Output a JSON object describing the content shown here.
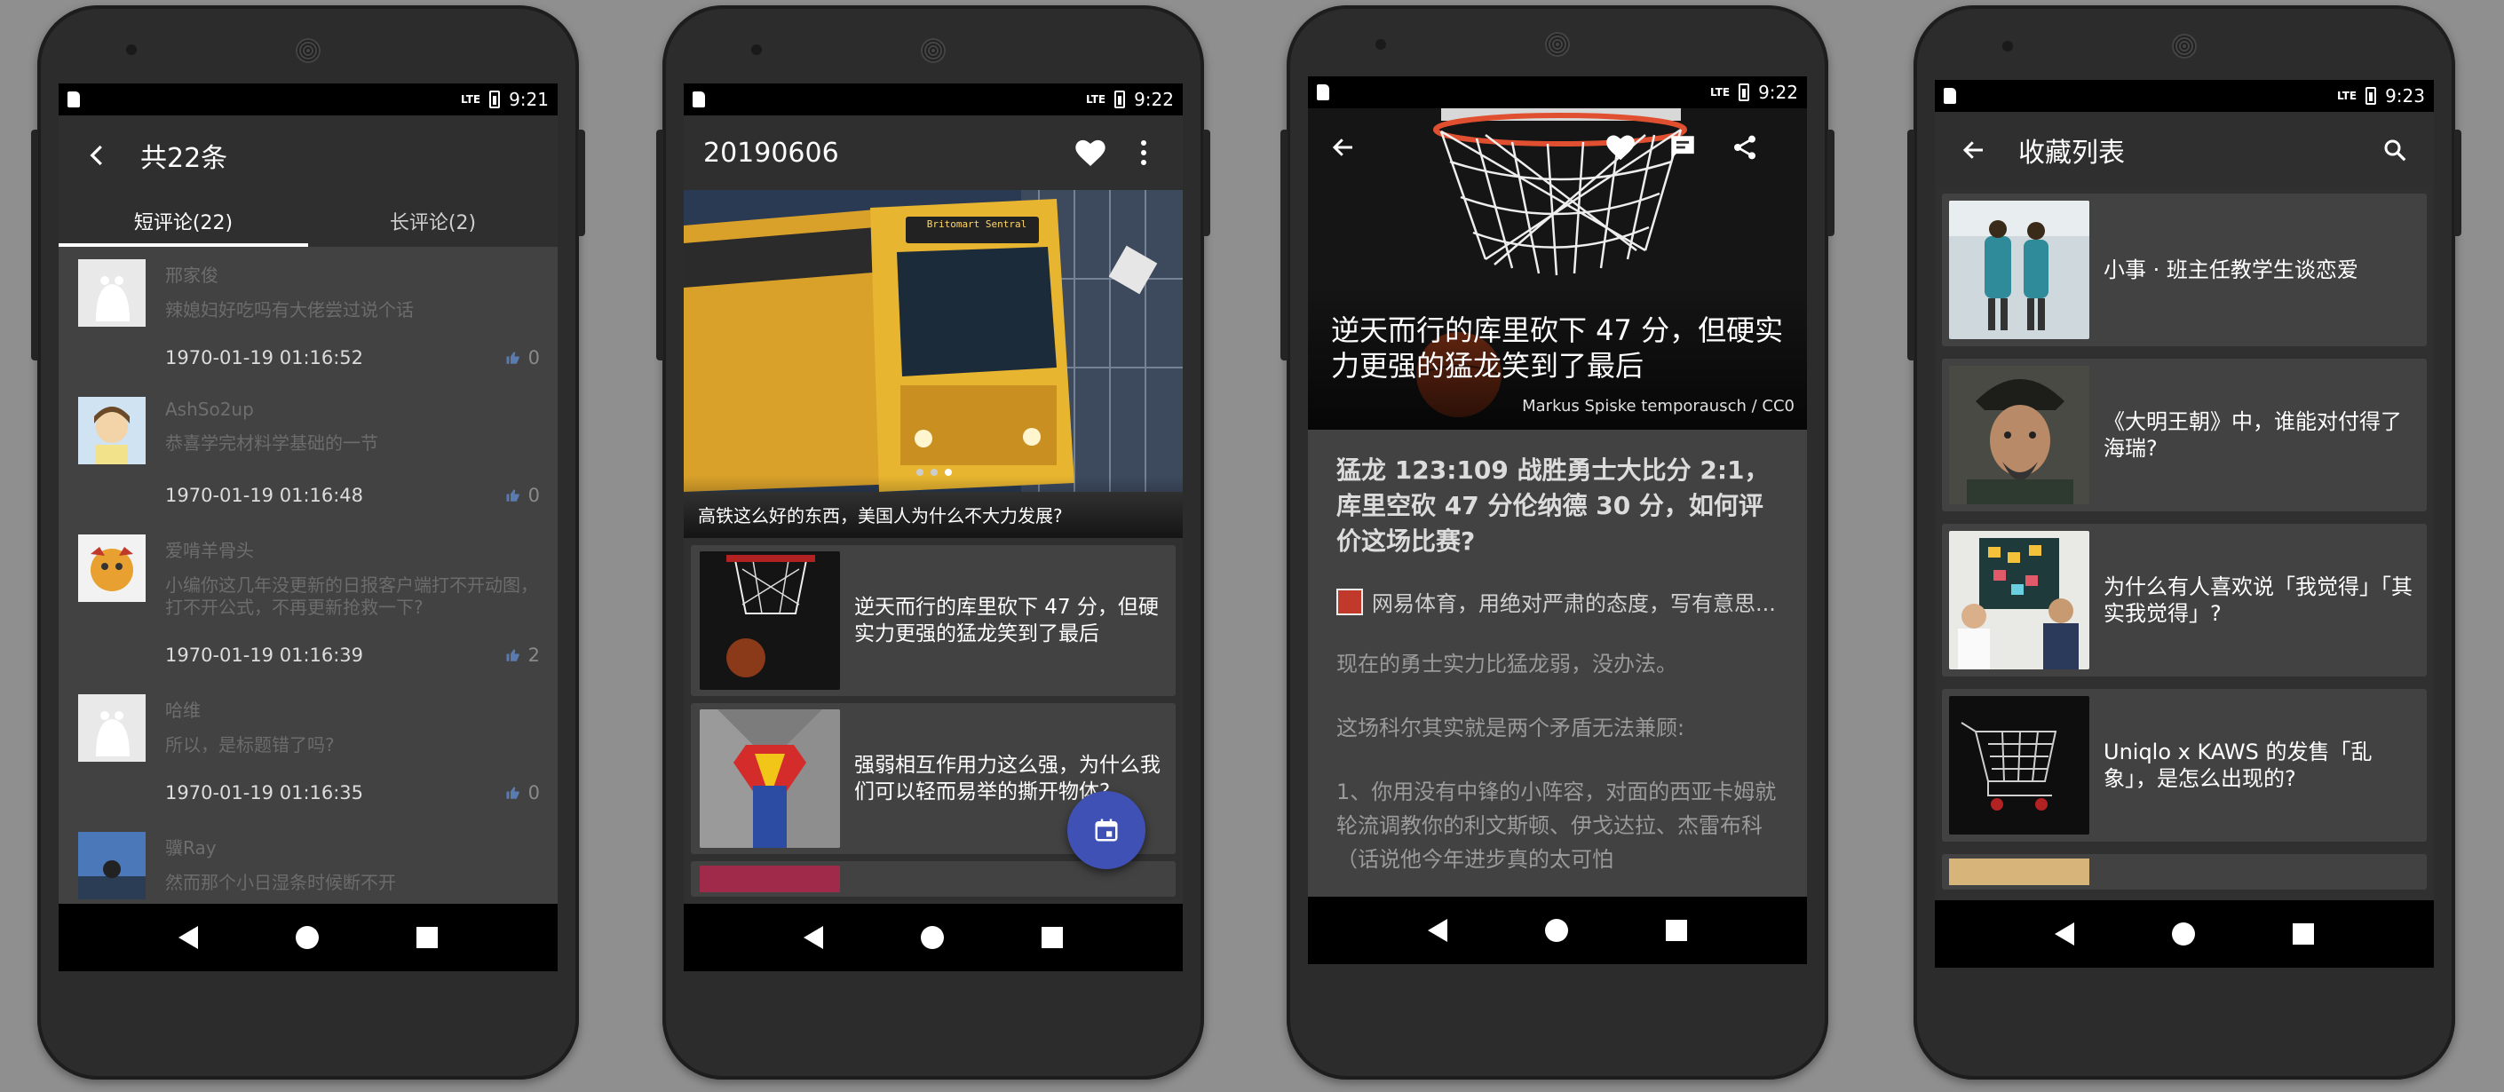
{
  "status": {
    "p1_time": "9:21",
    "p2_time": "9:22",
    "p3_time": "9:22",
    "p4_time": "9:23",
    "network": "LTE"
  },
  "comments_screen": {
    "title": "共22条",
    "tabs": [
      {
        "label": "短评论(22)"
      },
      {
        "label": "长评论(2)"
      }
    ],
    "comments": [
      {
        "name": "邢家俊",
        "text": "辣媳妇好吃吗有大佬尝过说个话",
        "time": "1970-01-19 01:16:52",
        "likes": "0"
      },
      {
        "name": "AshSo2up",
        "text": "恭喜学完材料学基础的一节",
        "time": "1970-01-19 01:16:48",
        "likes": "0"
      },
      {
        "name": "爱啃羊骨头",
        "text": "小编你这几年没更新的日报客户端打不开动图，打不开公式，不再更新抢救一下?",
        "time": "1970-01-19 01:16:39",
        "likes": "2"
      },
      {
        "name": "哈维",
        "text": "所以，是标题错了吗?",
        "time": "1970-01-19 01:16:35",
        "likes": "0"
      },
      {
        "name": "骥Ray",
        "text": "然而那个小日湿条时候断不开",
        "time": "",
        "likes": ""
      }
    ]
  },
  "daily_screen": {
    "title": "20190606",
    "hero_caption": "高铁这么好的东西，美国人为什么不大力发展?",
    "train_sign": "Britomart Sentral",
    "stories": [
      {
        "title": "逆天而行的库里砍下 47 分，但硬实力更强的猛龙笑到了最后"
      },
      {
        "title": "强弱相互作用力这么强，为什么我们可以轻而易举的撕开物体?"
      }
    ]
  },
  "article_screen": {
    "hero_title": "逆天而行的库里砍下 47 分，但硬实力更强的猛龙笑到了最后",
    "image_credit": "Markus Spiske temporausch / CC0",
    "question": "猛龙 123:109 战胜勇士大比分 2:1，库里空砍 47 分伦纳德 30 分，如何评价这场比赛?",
    "author": "网易体育，用绝对严肃的态度，写有意思...",
    "paragraphs": [
      "现在的勇士实力比猛龙弱，没办法。",
      "这场科尔其实就是两个矛盾无法兼顾:",
      "1、你用没有中锋的小阵容，对面的西亚卡姆就轮流调教你的利文斯顿、伊戈达拉、杰雷布科（话说他今年进步真的太可怕"
    ]
  },
  "favorites_screen": {
    "title": "收藏列表",
    "items": [
      {
        "title": "小事 · 班主任教学生谈恋爱"
      },
      {
        "title": "《大明王朝》中，谁能对付得了海瑞?"
      },
      {
        "title": "为什么有人喜欢说「我觉得」「其实我觉得」?"
      },
      {
        "title": "Uniqlo x KAWS 的发售「乱象」，是怎么出现的?"
      }
    ]
  },
  "colors": {
    "fab": "#3f51b5",
    "card": "#424242",
    "appbar": "#2f2f2f"
  }
}
